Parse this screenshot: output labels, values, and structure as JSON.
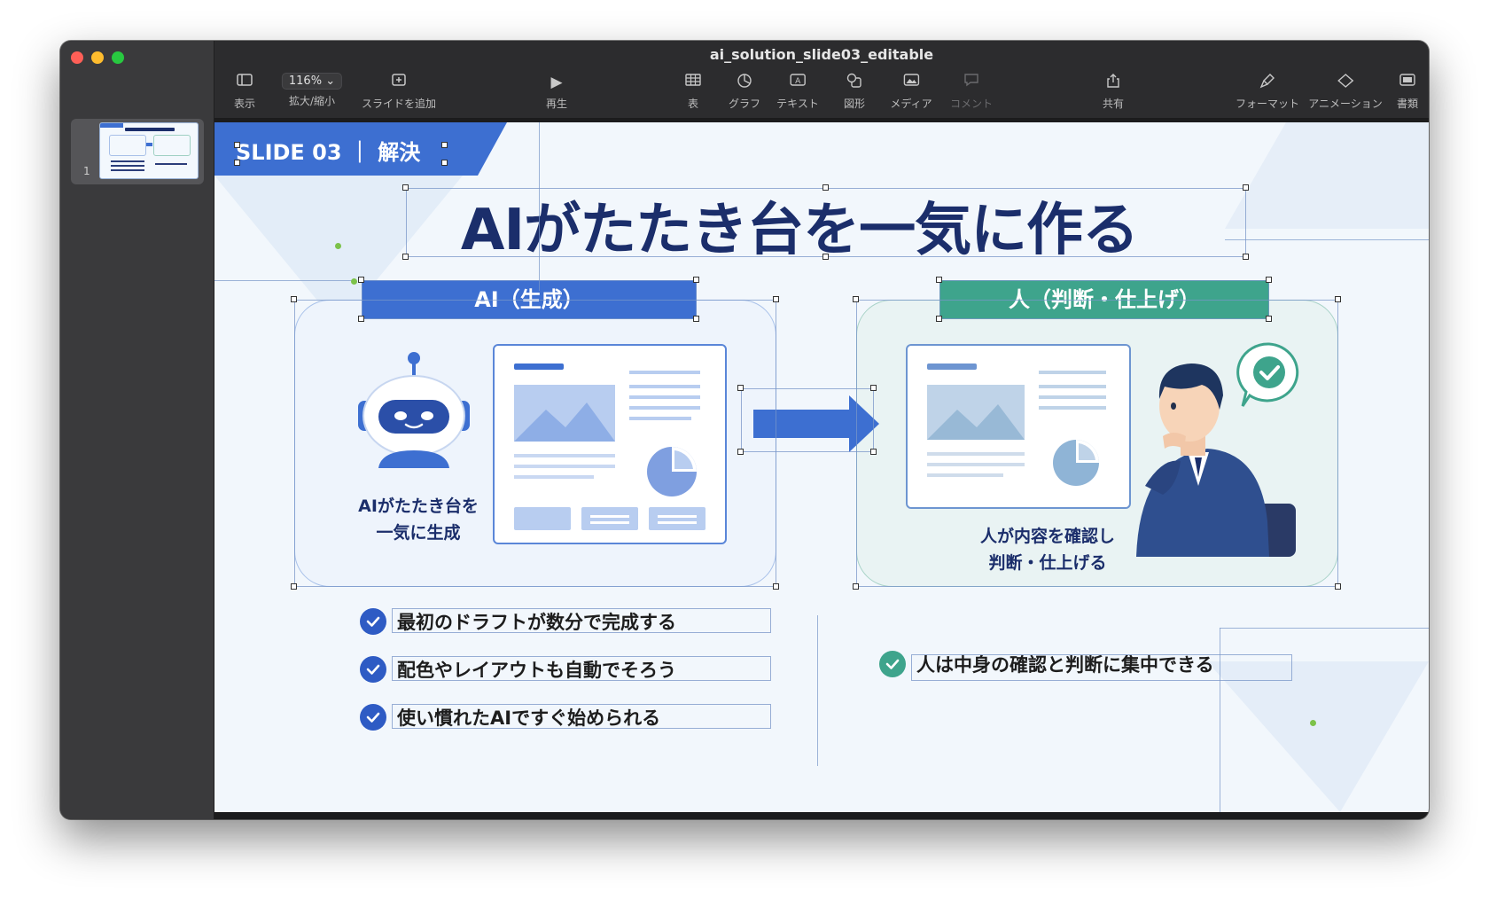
{
  "window": {
    "title": "ai_solution_slide03_editable"
  },
  "toolbar": {
    "view": "表示",
    "zoom_value": "116%",
    "zoom_label": "拡大/縮小",
    "add_slide": "スライドを追加",
    "play": "再生",
    "table": "表",
    "chart": "グラフ",
    "text": "テキスト",
    "shape": "図形",
    "media": "メディア",
    "comment": "コメント",
    "share": "共有",
    "format": "フォーマット",
    "animate": "アニメーション",
    "document": "書類"
  },
  "navigator": {
    "slide_number": "1"
  },
  "slide": {
    "tag": "SLIDE 03 ｜ 解決",
    "title": "AIがたたき台を一気に作る",
    "ai_header": "AI（生成）",
    "human_header": "人（判断・仕上げ）",
    "ai_caption_line1": "AIがたたき台を",
    "ai_caption_line2": "一気に生成",
    "human_caption_line1": "人が内容を確認し",
    "human_caption_line2": "判断・仕上げる",
    "ai_points": [
      "最初のドラフトが数分で完成する",
      "配色やレイアウトも自動でそろう",
      "使い慣れたAIですぐ始められる"
    ],
    "human_point": "人は中身の確認と判断に集中できる"
  },
  "colors": {
    "accent_blue": "#3d6fd1",
    "accent_green": "#3ea48c",
    "title_navy": "#1b2e6b"
  }
}
